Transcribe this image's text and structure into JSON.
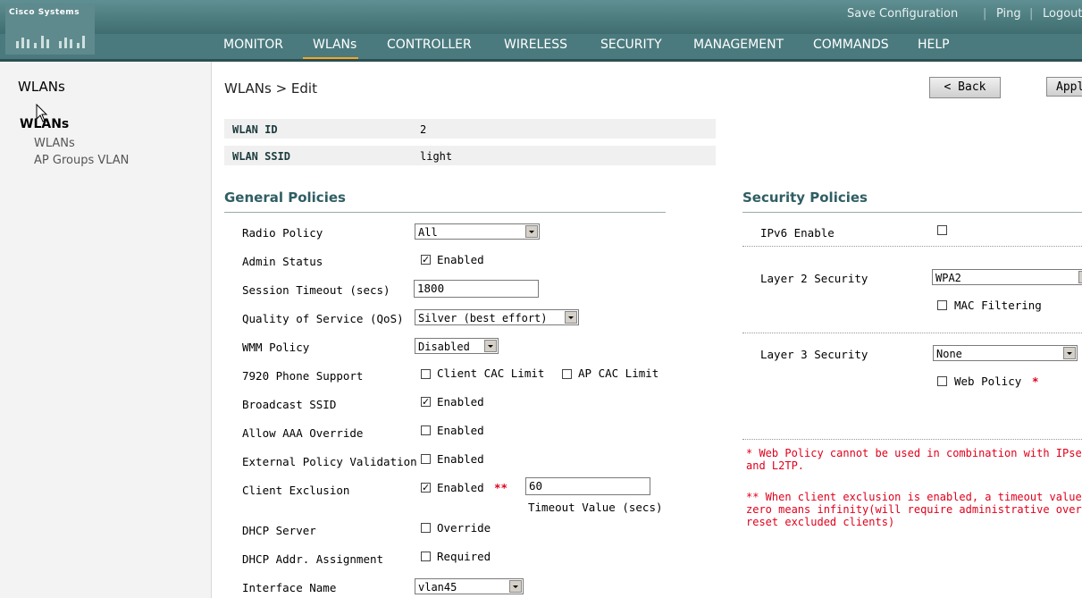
{
  "header": {
    "logo": "Cisco Systems",
    "links": [
      "Save Configuration",
      "Ping",
      "Logout"
    ],
    "nav": [
      "MONITOR",
      "WLANs",
      "CONTROLLER",
      "WIRELESS",
      "SECURITY",
      "MANAGEMENT",
      "COMMANDS",
      "HELP"
    ],
    "active_nav": "WLANs"
  },
  "sidebar": {
    "title": "WLANs",
    "section": "WLANs",
    "items": [
      "WLANs",
      "AP Groups VLAN"
    ]
  },
  "page": {
    "breadcrumb": "WLANs > Edit",
    "back_button": "< Back",
    "apply_button": "Apply"
  },
  "wlan": {
    "id_label": "WLAN ID",
    "id_value": "2",
    "ssid_label": "WLAN SSID",
    "ssid_value": "light"
  },
  "general": {
    "title": "General Policies",
    "radio_policy": {
      "label": "Radio Policy",
      "value": "All"
    },
    "admin_status": {
      "label": "Admin Status",
      "checkbox": "Enabled",
      "checked": true
    },
    "session_timeout": {
      "label": "Session Timeout (secs)",
      "value": "1800"
    },
    "qos": {
      "label": "Quality of Service (QoS)",
      "value": "Silver (best effort)"
    },
    "wmm": {
      "label": "WMM Policy",
      "value": "Disabled"
    },
    "phone": {
      "label": "7920 Phone Support",
      "client_cac": "Client CAC Limit",
      "ap_cac": "AP CAC Limit"
    },
    "broadcast_ssid": {
      "label": "Broadcast SSID",
      "checkbox": "Enabled",
      "checked": true
    },
    "aaa_override": {
      "label": "Allow AAA Override",
      "checkbox": "Enabled",
      "checked": false
    },
    "ext_policy": {
      "label": "External Policy Validation",
      "checkbox": "Enabled",
      "checked": false
    },
    "client_exclusion": {
      "label": "Client Exclusion",
      "checkbox": "Enabled",
      "checked": true,
      "marker": "**",
      "timeout_value": "60",
      "timeout_caption": "Timeout Value (secs)"
    },
    "dhcp_server": {
      "label": "DHCP Server",
      "checkbox": "Override",
      "checked": false
    },
    "dhcp_addr": {
      "label": "DHCP Addr. Assignment",
      "checkbox": "Required",
      "checked": false
    },
    "interface": {
      "label": "Interface Name",
      "value": "vlan45"
    }
  },
  "security": {
    "title": "Security Policies",
    "ipv6": {
      "label": "IPv6 Enable",
      "checked": false
    },
    "layer2": {
      "label": "Layer 2 Security",
      "value": "WPA2",
      "mac_filtering": "MAC Filtering"
    },
    "layer3": {
      "label": "Layer 3 Security",
      "value": "None",
      "web_policy": "Web Policy",
      "marker": "*"
    },
    "note1_line1": "* Web Policy cannot be used in combination with IPsec",
    "note1_line2": "and L2TP.",
    "note2_line1": "** When client exclusion is enabled, a timeout value of",
    "note2_line2": "zero means infinity(will require administrative override to",
    "note2_line3": "reset excluded clients)"
  },
  "colors": {
    "header": "#4a7a7e",
    "active_tab": "#f5a623",
    "section_title": "#2f5e63",
    "note": "#e0001b"
  }
}
